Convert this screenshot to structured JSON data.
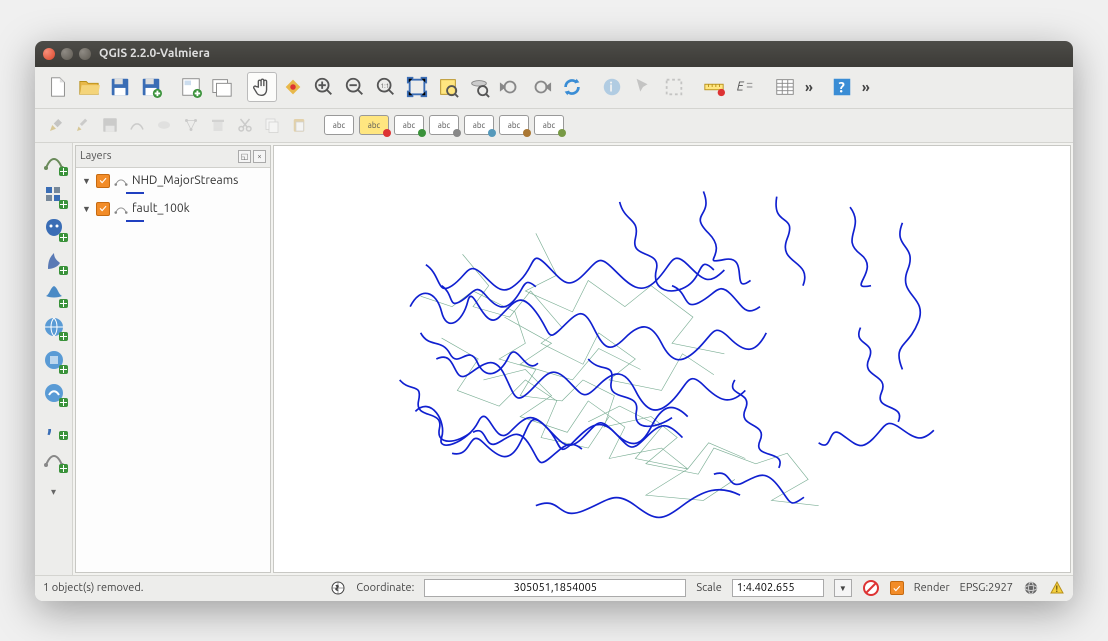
{
  "window": {
    "title": "QGIS 2.2.0-Valmiera"
  },
  "layers_panel": {
    "title": "Layers",
    "items": [
      {
        "name": "NHD_MajorStreams",
        "checked": true
      },
      {
        "name": "fault_100k",
        "checked": true
      }
    ]
  },
  "statusbar": {
    "message": "1 object(s) removed.",
    "coordinate_label": "Coordinate:",
    "coordinate_value": "305051,1854005",
    "scale_label": "Scale",
    "scale_value": "1:4.402.655",
    "render_label": "Render",
    "crs": "EPSG:2927"
  },
  "label_text": "abc"
}
